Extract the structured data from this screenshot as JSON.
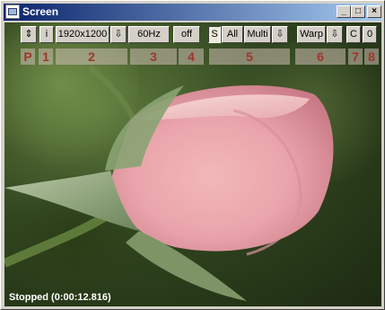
{
  "window": {
    "title": "Screen",
    "controls": [
      "_",
      "□",
      "×"
    ]
  },
  "toolbar": {
    "sync_icon": "sync-icon",
    "info_label": "i",
    "resolution_value": "1920x1200",
    "resolution_dropdown_icon": "arrow-down-icon",
    "refresh_value": "60Hz",
    "state_label": "off",
    "s_label": "S",
    "all_label": "All",
    "multi_label": "Multi",
    "multi_dropdown_icon": "arrow-down-icon",
    "warp_label": "Warp",
    "warp_dropdown_icon": "arrow-down-icon",
    "c_label": "C",
    "o_label": "0"
  },
  "segments": {
    "p": "P",
    "s1": "1",
    "s2": "2",
    "s3": "3",
    "s4": "4",
    "s5": "5",
    "s6": "6",
    "s7": "7",
    "s8": "8"
  },
  "status": {
    "text": "Stopped (0:00:12.816)"
  },
  "colors": {
    "titlebar_start": "#0a246a",
    "titlebar_end": "#a6caf0",
    "segment_label": "#a0362b"
  }
}
